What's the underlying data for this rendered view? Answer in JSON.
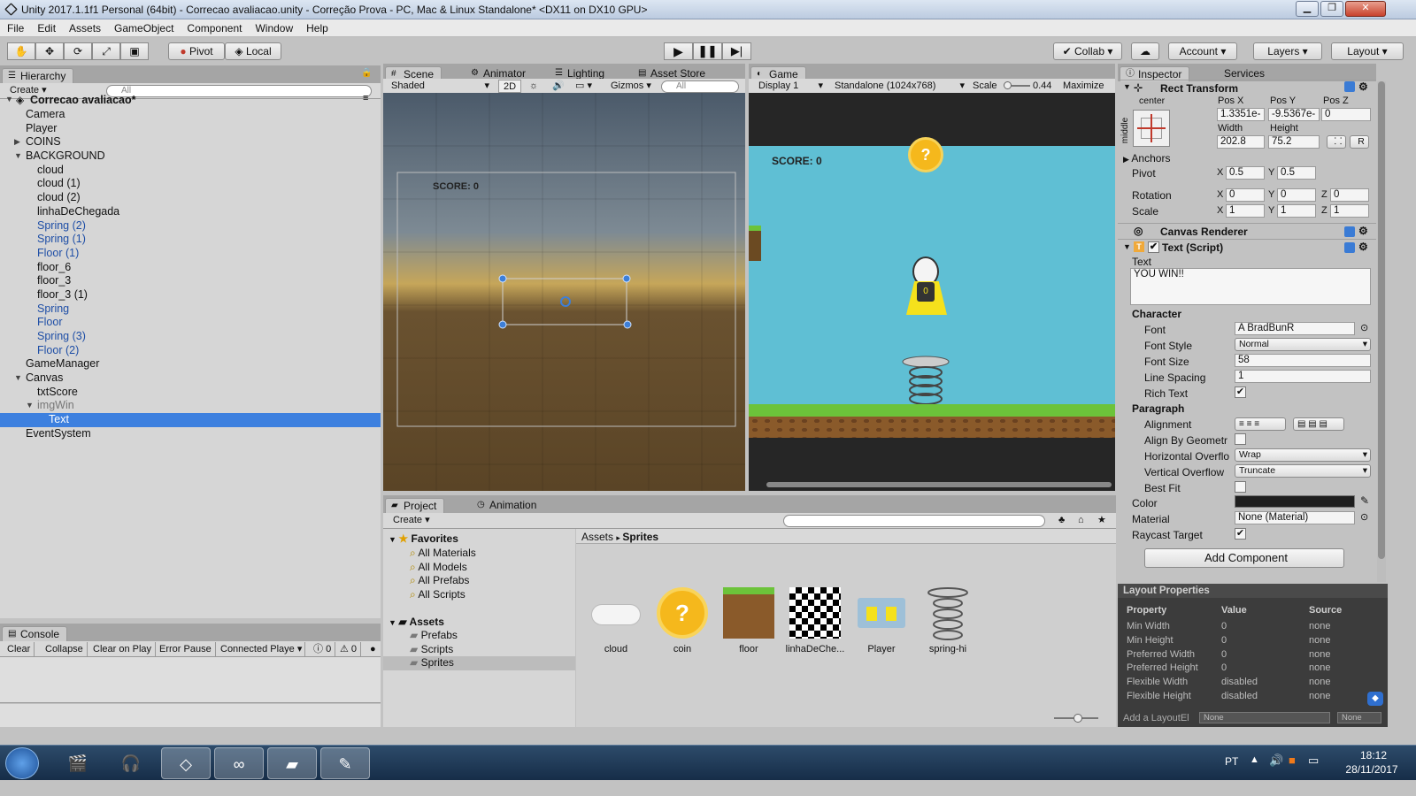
{
  "window": {
    "title": "Unity 2017.1.1f1 Personal (64bit) - Correcao avaliacao.unity - Correção Prova - PC, Mac & Linux Standalone* <DX11 on DX10 GPU>",
    "minimize": "▁",
    "maximize": "❐",
    "close": "✕"
  },
  "menu": [
    "File",
    "Edit",
    "Assets",
    "GameObject",
    "Component",
    "Window",
    "Help"
  ],
  "toolbar": {
    "pivot": "Pivot",
    "local": "Local",
    "collab": "Collab",
    "account": "Account",
    "layers": "Layers",
    "layout": "Layout"
  },
  "hierarchy": {
    "tab": "Hierarchy",
    "create": "Create",
    "search_placeholder": "All",
    "scene": "Correcao avaliacao*",
    "items": [
      {
        "label": "Camera",
        "indent": 1,
        "arrow": "",
        "style": "normal"
      },
      {
        "label": "Player",
        "indent": 1,
        "arrow": "",
        "style": "normal"
      },
      {
        "label": "COINS",
        "indent": 1,
        "arrow": "▶",
        "style": "normal"
      },
      {
        "label": "BACKGROUND",
        "indent": 1,
        "arrow": "▼",
        "style": "normal"
      },
      {
        "label": "cloud",
        "indent": 2,
        "arrow": "",
        "style": "normal"
      },
      {
        "label": "cloud (1)",
        "indent": 2,
        "arrow": "",
        "style": "normal"
      },
      {
        "label": "cloud (2)",
        "indent": 2,
        "arrow": "",
        "style": "normal"
      },
      {
        "label": "linhaDeChegada",
        "indent": 2,
        "arrow": "",
        "style": "normal"
      },
      {
        "label": "Spring (2)",
        "indent": 2,
        "arrow": "",
        "style": "prefab"
      },
      {
        "label": "Spring (1)",
        "indent": 2,
        "arrow": "",
        "style": "prefab"
      },
      {
        "label": "Floor (1)",
        "indent": 2,
        "arrow": "",
        "style": "prefab"
      },
      {
        "label": "floor_6",
        "indent": 2,
        "arrow": "",
        "style": "normal"
      },
      {
        "label": "floor_3",
        "indent": 2,
        "arrow": "",
        "style": "normal"
      },
      {
        "label": "floor_3 (1)",
        "indent": 2,
        "arrow": "",
        "style": "normal"
      },
      {
        "label": "Spring",
        "indent": 2,
        "arrow": "",
        "style": "prefab"
      },
      {
        "label": "Floor",
        "indent": 2,
        "arrow": "",
        "style": "prefab"
      },
      {
        "label": "Spring (3)",
        "indent": 2,
        "arrow": "",
        "style": "prefab"
      },
      {
        "label": "Floor (2)",
        "indent": 2,
        "arrow": "",
        "style": "prefab"
      },
      {
        "label": "GameManager",
        "indent": 1,
        "arrow": "",
        "style": "normal"
      },
      {
        "label": "Canvas",
        "indent": 1,
        "arrow": "▼",
        "style": "normal"
      },
      {
        "label": "txtScore",
        "indent": 2,
        "arrow": "",
        "style": "normal"
      },
      {
        "label": "imgWin",
        "indent": 2,
        "arrow": "▼",
        "style": "inactive"
      },
      {
        "label": "Text",
        "indent": 3,
        "arrow": "",
        "style": "selected"
      },
      {
        "label": "EventSystem",
        "indent": 1,
        "arrow": "",
        "style": "normal"
      }
    ]
  },
  "scene": {
    "tabs": [
      "Scene",
      "Animator",
      "Lighting",
      "Asset Store"
    ],
    "shading": "Shaded",
    "mode2d": "2D",
    "gizmos": "Gizmos",
    "search_placeholder": "All",
    "score_label": "SCORE: 0"
  },
  "game": {
    "tab": "Game",
    "display": "Display 1",
    "resolution": "Standalone (1024x768)",
    "scale_label": "Scale",
    "scale_value": "0.44",
    "maximize": "Maximize O",
    "score_label": "SCORE: 0"
  },
  "inspector": {
    "tabs": [
      "Inspector",
      "Services"
    ],
    "rect_transform": {
      "title": "Rect Transform",
      "anchor_h": "center",
      "anchor_v": "middle",
      "labels": [
        "Pos X",
        "Pos Y",
        "Pos Z",
        "Width",
        "Height"
      ],
      "pos_x": "1.3351e-",
      "pos_y": "-9.5367e-",
      "pos_z": "0",
      "width": "202.8",
      "height": "75.2",
      "r_button": "R",
      "anchors": "Anchors",
      "pivot_label": "Pivot",
      "pivot_x": "0.5",
      "pivot_y": "0.5",
      "rotation_label": "Rotation",
      "rot_x": "0",
      "rot_y": "0",
      "rot_z": "0",
      "scale_label": "Scale",
      "scale_x": "1",
      "scale_y": "1",
      "scale_z": "1",
      "x": "X",
      "y": "Y",
      "z": "Z"
    },
    "canvas_renderer": "Canvas Renderer",
    "text_script": {
      "title": "Text (Script)",
      "text_label": "Text",
      "text_value": "YOU WIN!!",
      "character": "Character",
      "font_label": "Font",
      "font_value": "BradBunR",
      "font_style_label": "Font Style",
      "font_style_value": "Normal",
      "font_size_label": "Font Size",
      "font_size_value": "58",
      "line_spacing_label": "Line Spacing",
      "line_spacing_value": "1",
      "rich_text_label": "Rich Text",
      "paragraph": "Paragraph",
      "alignment_label": "Alignment",
      "align_geom_label": "Align By Geometr",
      "h_overflow_label": "Horizontal Overflo",
      "h_overflow_value": "Wrap",
      "v_overflow_label": "Vertical Overflow",
      "v_overflow_value": "Truncate",
      "best_fit_label": "Best Fit",
      "color_label": "Color",
      "material_label": "Material",
      "material_value": "None (Material)",
      "raycast_label": "Raycast Target",
      "add_component": "Add Component"
    }
  },
  "layout_properties": {
    "title": "Layout Properties",
    "headers": [
      "Property",
      "Value",
      "Source"
    ],
    "rows": [
      [
        "Min Width",
        "0",
        "none"
      ],
      [
        "Min Height",
        "0",
        "none"
      ],
      [
        "Preferred Width",
        "0",
        "none"
      ],
      [
        "Preferred Height",
        "0",
        "none"
      ],
      [
        "Flexible Width",
        "disabled",
        "none"
      ],
      [
        "Flexible Height",
        "disabled",
        "none"
      ]
    ],
    "footer": "Add a LayoutEl",
    "footer_dd1": "None",
    "footer_dd2": "None"
  },
  "project": {
    "tabs": [
      "Project",
      "Animation"
    ],
    "create": "Create",
    "favorites": "Favorites",
    "favorite_items": [
      "All Materials",
      "All Models",
      "All Prefabs",
      "All Scripts"
    ],
    "assets": "Assets",
    "asset_folders": [
      "Prefabs",
      "Scripts",
      "Sprites"
    ],
    "breadcrumb": [
      "Assets",
      "Sprites"
    ],
    "sprites": [
      "cloud",
      "coin",
      "floor",
      "linhaDeChe...",
      "Player",
      "spring-hi"
    ]
  },
  "console": {
    "tab": "Console",
    "buttons": [
      "Clear",
      "Collapse",
      "Clear on Play",
      "Error Pause",
      "Connected Playe"
    ],
    "warn_count": "0",
    "error_count": "0"
  },
  "taskbar": {
    "language": "PT",
    "time": "18:12",
    "date": "28/11/2017"
  },
  "colors": {
    "selection": "#3d80df",
    "prefab_text": "#1e4ea6",
    "game_sky": "#5fbfd4",
    "grass": "#6cc33a",
    "coin": "#f5b81c"
  }
}
